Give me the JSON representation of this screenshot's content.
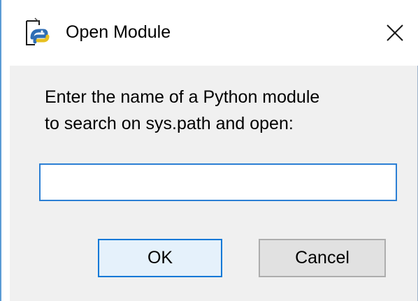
{
  "window": {
    "title": "Open Module",
    "icon": "python-idle-icon",
    "close_glyph": "✕"
  },
  "dialog": {
    "prompt_line1": "Enter the name of a Python module",
    "prompt_line2": "to search on sys.path and open:",
    "module_input_value": "",
    "module_input_placeholder": ""
  },
  "buttons": {
    "ok_label": "OK",
    "cancel_label": "Cancel"
  },
  "colors": {
    "accent": "#0078d7",
    "input_border": "#2b7fd4",
    "dialog_background": "#f0f0f0"
  }
}
